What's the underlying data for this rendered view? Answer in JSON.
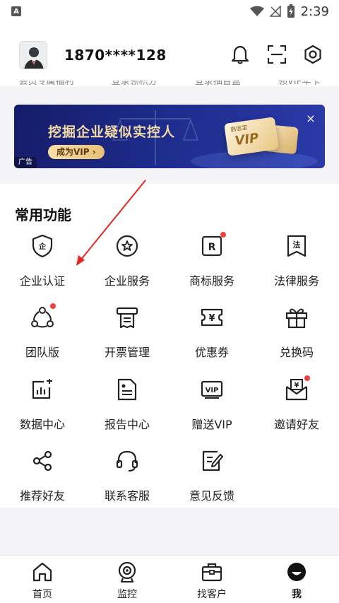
{
  "status_bar": {
    "time": "2:39"
  },
  "header": {
    "phone": "1870****128",
    "hidden_labels": [
      "会员专属福利",
      "登录领积分",
      "登录抽盲盒",
      "领VIP年卡"
    ]
  },
  "ad": {
    "title": "挖掘企业疑似实控人",
    "button": "成为VIP ›",
    "tag": "广告",
    "close": "×",
    "card_label": "启信宝",
    "card_text": "VIP"
  },
  "functions": {
    "title": "常用功能",
    "items": [
      {
        "label": "企业认证",
        "icon": "shield-enterprise-icon",
        "dot": false
      },
      {
        "label": "企业服务",
        "icon": "star-circle-icon",
        "dot": false
      },
      {
        "label": "商标服务",
        "icon": "trademark-icon",
        "dot": true
      },
      {
        "label": "法律服务",
        "icon": "law-book-icon",
        "dot": false
      },
      {
        "label": "团队版",
        "icon": "team-icon",
        "dot": true
      },
      {
        "label": "开票管理",
        "icon": "invoice-icon",
        "dot": false
      },
      {
        "label": "优惠券",
        "icon": "coupon-icon",
        "dot": false
      },
      {
        "label": "兑换码",
        "icon": "gift-icon",
        "dot": false
      },
      {
        "label": "数据中心",
        "icon": "data-chart-icon",
        "dot": false
      },
      {
        "label": "报告中心",
        "icon": "report-icon",
        "dot": false
      },
      {
        "label": "赠送VIP",
        "icon": "vip-icon",
        "dot": false
      },
      {
        "label": "邀请好友",
        "icon": "invite-envelope-icon",
        "dot": true
      },
      {
        "label": "推荐好友",
        "icon": "share-icon",
        "dot": false
      },
      {
        "label": "联系客服",
        "icon": "headset-icon",
        "dot": false
      },
      {
        "label": "意见反馈",
        "icon": "feedback-icon",
        "dot": false
      }
    ]
  },
  "tabs": [
    {
      "label": "首页",
      "icon": "home-icon",
      "active": false
    },
    {
      "label": "监控",
      "icon": "monitor-camera-icon",
      "active": false
    },
    {
      "label": "找客户",
      "icon": "briefcase-icon",
      "active": false
    },
    {
      "label": "我",
      "icon": "me-face-icon",
      "active": true
    }
  ],
  "colors": {
    "accent_red": "#f0413d",
    "ad_bg": "#1d2b8a",
    "ad_gold": "#f3d9a3"
  }
}
